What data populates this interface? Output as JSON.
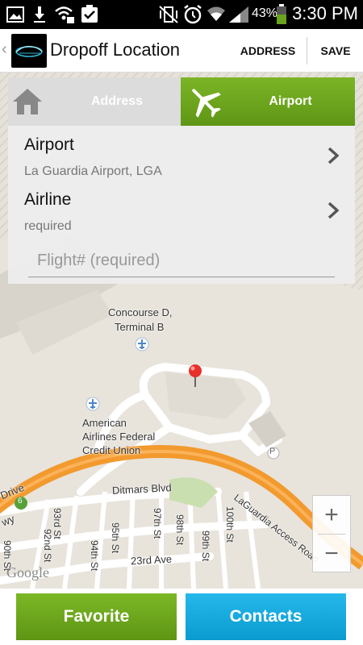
{
  "status_bar": {
    "battery_percent": "43%",
    "time": "3:30 PM",
    "icons": [
      "image-icon",
      "download-icon",
      "wifi-lock-icon",
      "clipboard-check-icon",
      "vibrate-muted-icon",
      "alarm-icon",
      "wifi-icon",
      "signal-icon",
      "battery-icon"
    ]
  },
  "action_bar": {
    "title": "Dropoff Location",
    "address_button": "ADDRESS",
    "save_button": "SAVE"
  },
  "tabs": {
    "address": "Address",
    "airport": "Airport",
    "selected": "airport"
  },
  "form": {
    "airport": {
      "title": "Airport",
      "value": "La Guardia Airport, LGA"
    },
    "airline": {
      "title": "Airline",
      "value": "required"
    },
    "flight_placeholder": "Flight# (required)",
    "flight_value": ""
  },
  "map": {
    "labels": {
      "concourse_line1": "Concourse D,",
      "concourse_line2": "Terminal B",
      "credit_union_line1": "American",
      "credit_union_line2": "Airlines Federal",
      "credit_union_line3": "Credit Union",
      "ditmars": "Ditmars Blvd",
      "laguardia_access": "LaGuardia Access Road",
      "drive": "Drive",
      "wy": "wy",
      "route_shield": "6",
      "parking": "P",
      "st_93rd": "93rd St",
      "st_92nd": "92nd St",
      "st_94th": "94th St",
      "st_95th": "95th St",
      "st_97th": "97th St",
      "st_98th": "98th St",
      "st_99th": "99th St",
      "st_100th": "100th St",
      "st_90th": "90th St",
      "ave_23rd": "23rd Ave"
    },
    "attribution": "Google",
    "zoom_in": "+",
    "zoom_out": "−"
  },
  "bottom": {
    "favorite": "Favorite",
    "contacts": "Contacts"
  },
  "colors": {
    "green": "#6aa31c",
    "blue": "#14a9de",
    "highway_orange": "#f29a2e",
    "map_bg": "#e8e4dc"
  }
}
